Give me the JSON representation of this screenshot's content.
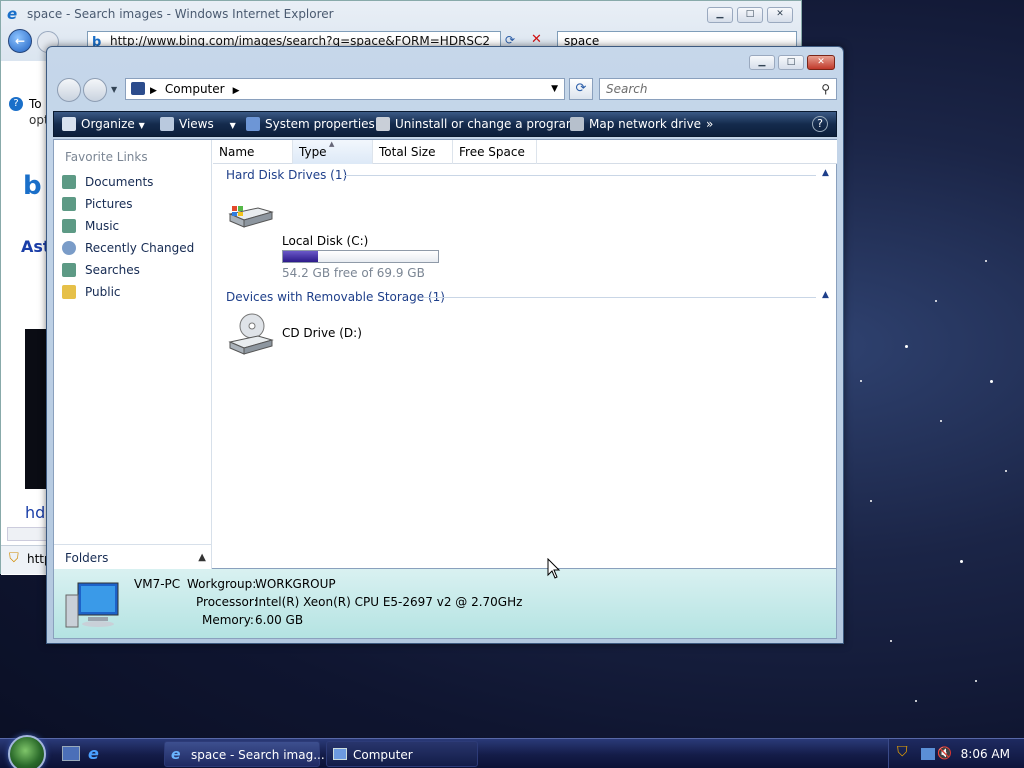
{
  "ie": {
    "title": "space - Search images - Windows Internet Explorer",
    "address": "http://www.bing.com/images/search?q=space&FORM=HDRSC2",
    "search_value": "space",
    "side_text": [
      "To",
      "opt",
      "Ast",
      "hdc",
      "http"
    ]
  },
  "explorer": {
    "breadcrumb": "Computer",
    "search_placeholder": "Search",
    "toolbar": {
      "organize": "Organize",
      "views": "Views",
      "system_properties": "System properties",
      "uninstall": "Uninstall or change a program",
      "map_drive": "Map network drive",
      "more": "»"
    },
    "nav": {
      "favorite_links_title": "Favorite Links",
      "items": [
        "Documents",
        "Pictures",
        "Music",
        "Recently Changed",
        "Searches",
        "Public"
      ],
      "folders": "Folders"
    },
    "columns": [
      "Name",
      "Type",
      "Total Size",
      "Free Space"
    ],
    "groups": [
      {
        "label": "Hard Disk Drives (1)"
      },
      {
        "label": "Devices with Removable Storage (1)"
      }
    ],
    "drives": {
      "local": {
        "name": "Local Disk (C:)",
        "free_text": "54.2 GB free of 69.9 GB",
        "used_fraction": 0.225
      },
      "cd": {
        "name": "CD Drive (D:)"
      }
    },
    "details": {
      "computer_name": "VM7-PC",
      "workgroup_label": "Workgroup:",
      "workgroup": "WORKGROUP",
      "processor_label": "Processor:",
      "processor": "Intel(R) Xeon(R) CPU E5-2697 v2 @ 2.70GHz",
      "memory_label": "Memory:",
      "memory": "6.00 GB"
    }
  },
  "taskbar": {
    "tasks": [
      "space - Search imag...",
      "Computer"
    ],
    "clock": "8:06 AM"
  },
  "colors": {
    "toolbar": "#142b4d",
    "details": "#b4e3e2",
    "link": "#1e3f8a"
  }
}
